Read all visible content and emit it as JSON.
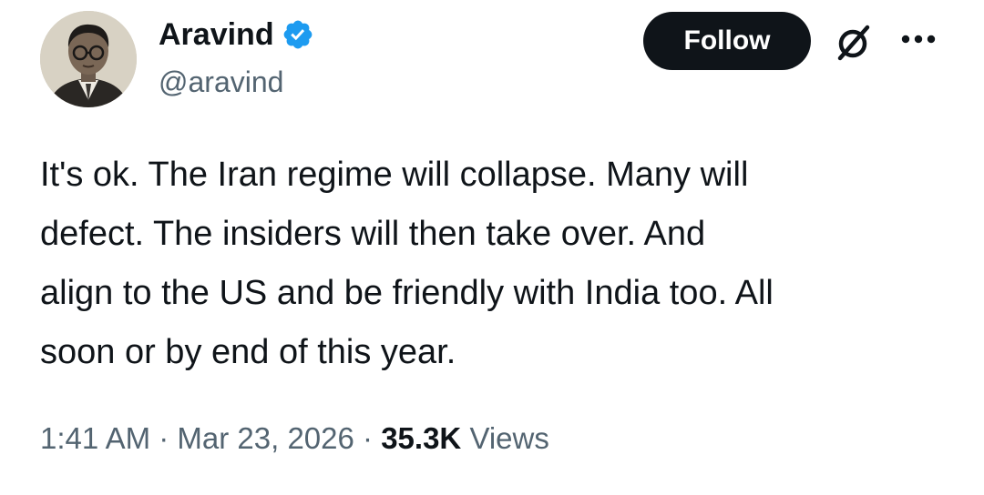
{
  "author": {
    "display_name": "Aravind",
    "handle": "@aravind",
    "verified": true,
    "avatar_icon": "portrait-avatar"
  },
  "actions": {
    "follow_label": "Follow",
    "grok_icon": "grok-slash-circle-icon",
    "more_icon": "more-horizontal-icon"
  },
  "tweet": {
    "text": "It's ok. The Iran regime will collapse. Many will\ndefect. The insiders will then take over. And\nalign to the US and be friendly with India too. All\nsoon or by end of this year."
  },
  "meta": {
    "time": "1:41 AM",
    "separator": " · ",
    "date": "Mar 23, 2026",
    "views_count": "35.3K",
    "views_label": "Views"
  },
  "colors": {
    "text_primary": "#0f1419",
    "text_secondary": "#536471",
    "verified_blue": "#1d9bf0",
    "follow_bg": "#0f1419",
    "follow_text": "#ffffff"
  }
}
